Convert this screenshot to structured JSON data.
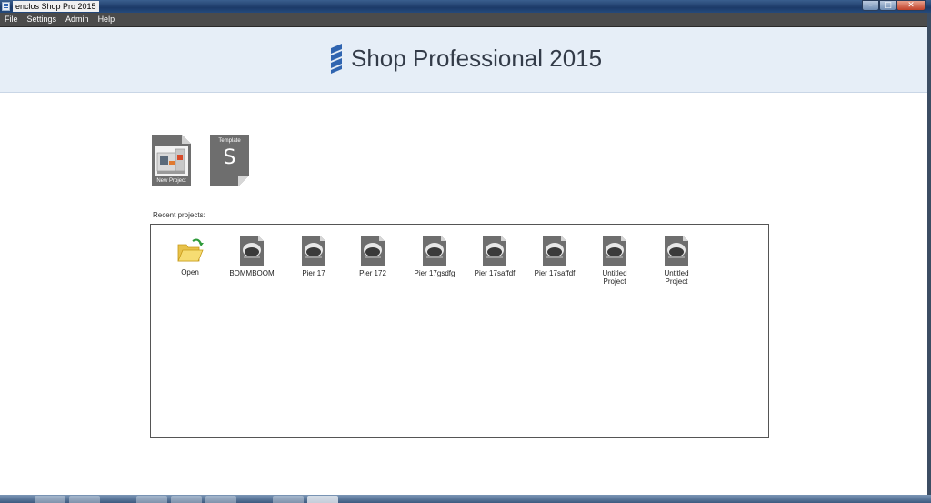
{
  "window": {
    "title": "enclos Shop Pro 2015",
    "buttons": {
      "minimize": "–",
      "maximize": "□",
      "close": "✕"
    }
  },
  "menu": [
    "File",
    "Settings",
    "Admin",
    "Help"
  ],
  "banner": {
    "title": "Shop Professional 2015",
    "logo_color": "#2f64b0"
  },
  "tiles": {
    "new_project": {
      "caption": "New Project",
      "icon": "machine-icon"
    },
    "template": {
      "caption": "Template",
      "letter": "S",
      "icon": "template-icon"
    }
  },
  "recent": {
    "label": "Recent projects:",
    "open": {
      "label": "Open",
      "icon": "folder-open-icon"
    },
    "projects": [
      {
        "label": "BOMMBOOM"
      },
      {
        "label": "Pier 17"
      },
      {
        "label": "Pier 172"
      },
      {
        "label": "Pier 17gsdfg"
      },
      {
        "label": "Pier 17saffdf"
      },
      {
        "label": "Pier 17saffdf"
      },
      {
        "label": "Untitled Project"
      },
      {
        "label": "Untitled Project"
      }
    ]
  },
  "colors": {
    "menubar": "#4b4b4b",
    "banner_bg": "#e6eef7",
    "tile_gray": "#6e6e6e"
  }
}
